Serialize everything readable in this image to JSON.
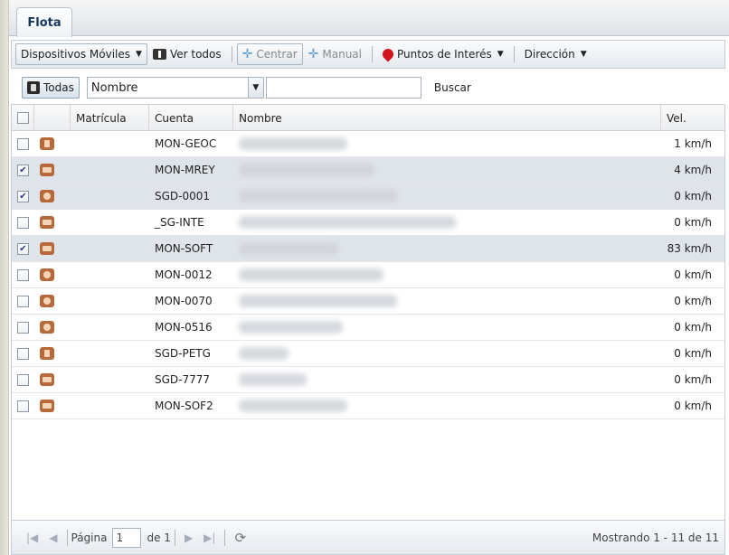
{
  "tab": {
    "label": "Flota"
  },
  "toolbar": {
    "dispositivos": "Dispositivos Móviles",
    "ver_todos": "Ver todos",
    "centrar": "Centrar",
    "manual": "Manual",
    "puntos": "Puntos de Interés",
    "direccion": "Dirección"
  },
  "search": {
    "todas": "Todas",
    "field": "Nombre",
    "query": "",
    "buscar": "Buscar"
  },
  "grid": {
    "columns": [
      "Matrícula",
      "Cuenta",
      "Nombre",
      "Vel."
    ],
    "rows": [
      {
        "checked": false,
        "icon": "person-icon",
        "matricula": "",
        "cuenta": "MON-GEOC",
        "vel": "1 km/h"
      },
      {
        "checked": true,
        "icon": "chat-icon",
        "matricula": "",
        "cuenta": "MON-MREY",
        "vel": "4 km/h"
      },
      {
        "checked": true,
        "icon": "face-icon",
        "matricula": "",
        "cuenta": "SGD-0001",
        "vel": "0 km/h"
      },
      {
        "checked": false,
        "icon": "chat-icon",
        "matricula": "",
        "cuenta": "_SG-INTE",
        "vel": "0 km/h"
      },
      {
        "checked": true,
        "icon": "chat-icon",
        "matricula": "",
        "cuenta": "MON-SOFT",
        "vel": "83 km/h"
      },
      {
        "checked": false,
        "icon": "face-icon",
        "matricula": "",
        "cuenta": "MON-0012",
        "vel": "0 km/h"
      },
      {
        "checked": false,
        "icon": "face-icon",
        "matricula": "",
        "cuenta": "MON-0070",
        "vel": "0 km/h"
      },
      {
        "checked": false,
        "icon": "face-icon",
        "matricula": "",
        "cuenta": "MON-0516",
        "vel": "0 km/h"
      },
      {
        "checked": false,
        "icon": "person-icon",
        "matricula": "",
        "cuenta": "SGD-PETG",
        "vel": "0 km/h"
      },
      {
        "checked": false,
        "icon": "chat-icon",
        "matricula": "",
        "cuenta": "SGD-7777",
        "vel": "0 km/h"
      },
      {
        "checked": false,
        "icon": "chat-icon",
        "matricula": "",
        "cuenta": "MON-SOF2",
        "vel": "0 km/h"
      }
    ]
  },
  "pager": {
    "page_label": "Página",
    "page": "1",
    "of": "de 1",
    "status": "Mostrando 1 - 11 de 11"
  }
}
